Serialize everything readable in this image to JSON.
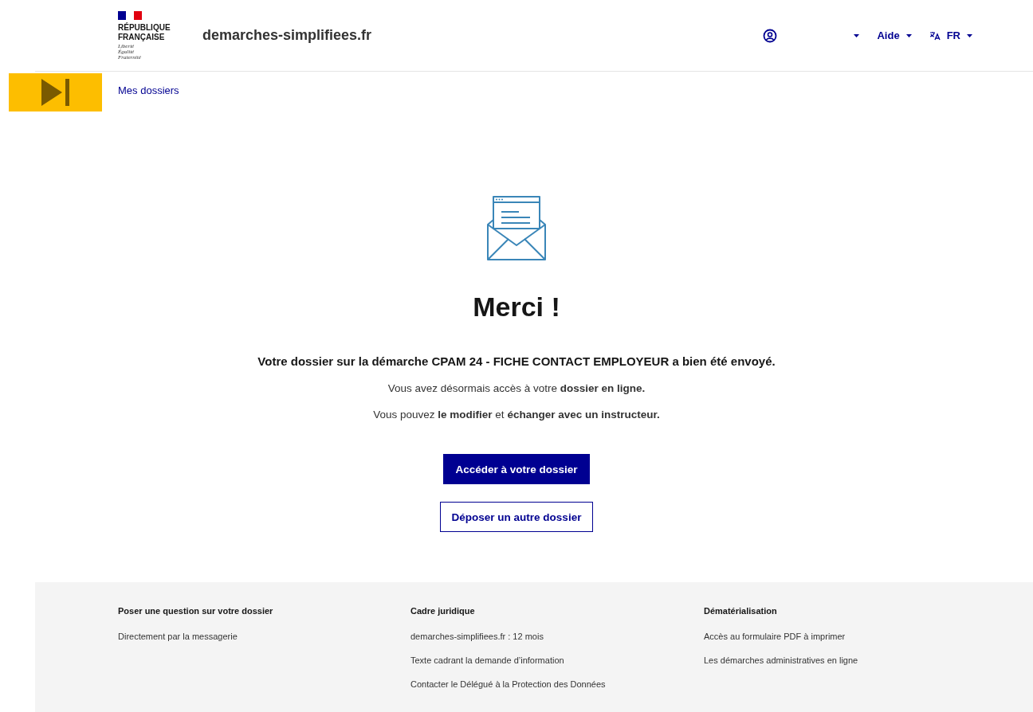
{
  "header": {
    "brand": {
      "line_1": "RÉPUBLIQUE",
      "line_2": "FRANÇAISE",
      "motto": [
        "Liberté",
        "Égalité",
        "Fraternité"
      ]
    },
    "site_name": "demarches-simplifiees.fr",
    "nav": [
      {
        "kind": "account"
      },
      {
        "kind": "menu",
        "label": "Aide"
      },
      {
        "kind": "language",
        "label": "FR"
      }
    ]
  },
  "skip_button": {
    "kind": "skip"
  },
  "breadcrumb": "Mes dossiers",
  "confirmation": {
    "title": "Merci !",
    "lead": "Votre dossier sur la démarche CPAM 24 - FICHE CONTACT EMPLOYEUR a bien été envoyé.",
    "lines": [
      "Vous avez désormais accès à votre **dossier en ligne.**",
      "Vous pouvez **le modifier** et **échanger avec un instructeur.**"
    ],
    "buttons": [
      {
        "kind": "primary",
        "label": "Accéder à votre dossier"
      },
      {
        "kind": "secondary",
        "label": "Déposer un autre dossier"
      }
    ]
  },
  "footer": {
    "columns": [
      {
        "title": "Poser une question sur votre dossier",
        "links": [
          "Directement par la messagerie"
        ]
      },
      {
        "title": "Cadre juridique",
        "links": [
          "demarches-simplifiees.fr : 12 mois",
          "Texte cadrant la demande d’information",
          "Contacter le Délégué à la Protection des Données"
        ]
      },
      {
        "title": "Dématérialisation",
        "links": [
          "Accès au formulaire PDF à imprimer",
          "Les démarches administratives en ligne"
        ]
      }
    ]
  }
}
